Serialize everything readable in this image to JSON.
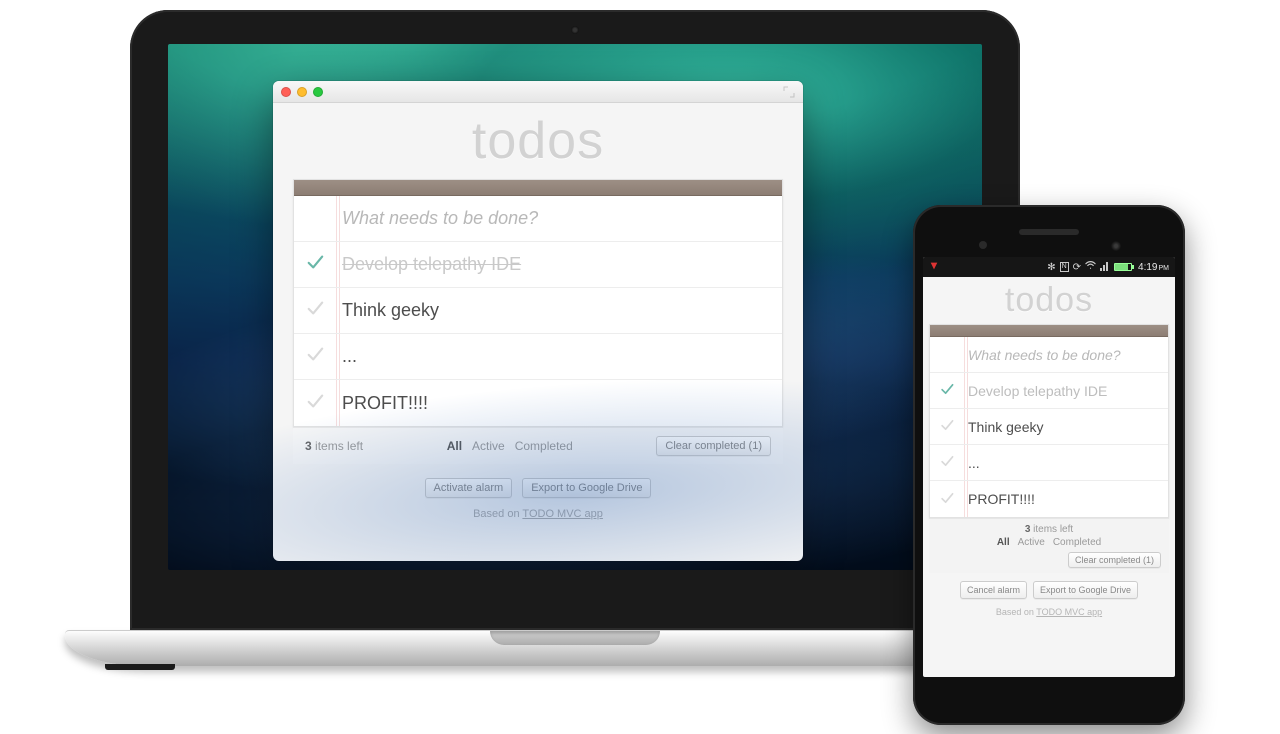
{
  "app_title": "todos",
  "new_todo_placeholder": "What needs to be done?",
  "items": [
    {
      "text": "Develop telepathy IDE",
      "completed": true
    },
    {
      "text": "Think geeky",
      "completed": false
    },
    {
      "text": "...",
      "completed": false
    },
    {
      "text": "PROFIT!!!!",
      "completed": false
    }
  ],
  "footer": {
    "count_number": "3",
    "count_text": " items left",
    "filters": {
      "all": "All",
      "active": "Active",
      "completed": "Completed"
    },
    "clear_completed": "Clear completed (1)"
  },
  "desktop_actions": {
    "alarm": "Activate alarm",
    "export": "Export to Google Drive"
  },
  "phone_actions": {
    "alarm": "Cancel alarm",
    "export": "Export to Google Drive"
  },
  "credit": {
    "prefix": "Based on ",
    "link": "TODO MVC app"
  },
  "android_status": {
    "time": "4:19",
    "meridiem": "PM"
  }
}
